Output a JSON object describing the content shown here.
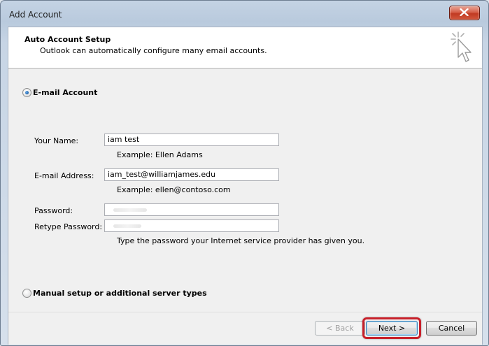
{
  "window": {
    "title": "Add Account"
  },
  "header": {
    "title": "Auto Account Setup",
    "subtitle": "Outlook can automatically configure many email accounts.",
    "icon": "cursor-click-icon"
  },
  "options": {
    "email_account": {
      "label": "E-mail Account",
      "selected": true
    },
    "manual_setup": {
      "label": "Manual setup or additional server types",
      "selected": false
    }
  },
  "form": {
    "name": {
      "label": "Your Name:",
      "value": "iam test",
      "example": "Example: Ellen Adams"
    },
    "email": {
      "label": "E-mail Address:",
      "value": "iam_test@williamjames.edu",
      "example": "Example: ellen@contoso.com"
    },
    "password": {
      "label": "Password:"
    },
    "retype_password": {
      "label": "Retype Password:"
    },
    "password_hint": "Type the password your Internet service provider has given you."
  },
  "buttons": {
    "back": "< Back",
    "next": "Next >",
    "cancel": "Cancel"
  },
  "colors": {
    "highlight": "#c8202a",
    "close_button": "#c13a22"
  }
}
